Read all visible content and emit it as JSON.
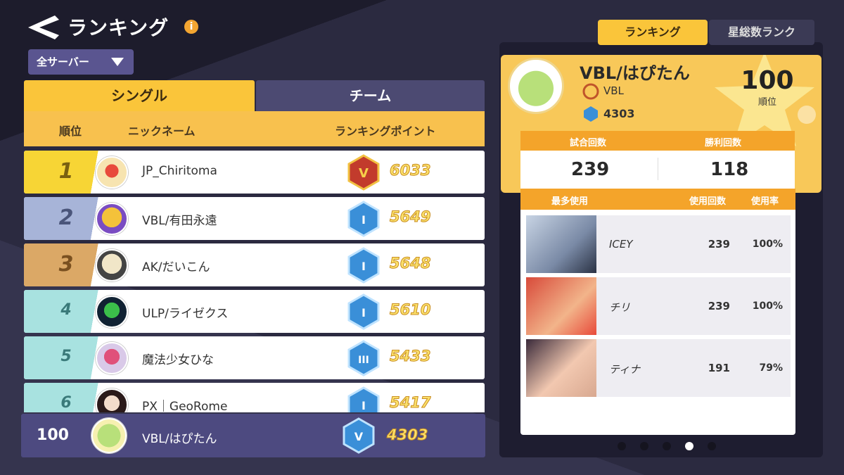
{
  "header": {
    "title": "ランキング",
    "info": "i",
    "server": "全サーバー"
  },
  "tabs": {
    "single": "シングル",
    "team": "チーム"
  },
  "columns": {
    "rank": "順位",
    "nickname": "ニックネーム",
    "points": "ランキングポイント"
  },
  "rows": [
    {
      "rank": "1",
      "nickname": "JP_Chiritoma",
      "points": "6033"
    },
    {
      "rank": "2",
      "nickname": "VBL/有田永遠",
      "points": "5649"
    },
    {
      "rank": "3",
      "nickname": "AK/だいこん",
      "points": "5648"
    },
    {
      "rank": "4",
      "nickname": "ULP/ライゼクス",
      "points": "5610"
    },
    {
      "rank": "5",
      "nickname": "魔法少女ひな",
      "points": "5433"
    },
    {
      "rank": "6",
      "nickname": "PX｜GeoRome",
      "points": "5417"
    }
  ],
  "own": {
    "rank": "100",
    "nickname": "VBL/はぴたん",
    "points": "4303"
  },
  "right_tabs": {
    "ranking": "ランキング",
    "star": "星総数ランク"
  },
  "profile": {
    "name": "VBL/はぴたん",
    "team": "VBL",
    "points": "4303",
    "rank": "100",
    "rank_unit": "順位"
  },
  "stats": {
    "matches_label": "試合回数",
    "wins_label": "勝利回数",
    "matches": "239",
    "wins": "118"
  },
  "most_used": {
    "label": "最多使用",
    "count_label": "使用回数",
    "rate_label": "使用率",
    "heroes": [
      {
        "name": "ICEY",
        "count": "239",
        "rate": "100%"
      },
      {
        "name": "チリ",
        "count": "239",
        "rate": "100%"
      },
      {
        "name": "ティナ",
        "count": "191",
        "rate": "79%"
      }
    ]
  },
  "colors": {
    "gold": "#fac53a",
    "rank1": "#f5d23a",
    "rank2": "#a7b4d8",
    "rank3": "#d9a867",
    "rank_other": "#a8e2e0",
    "own_row": "#4d4a80"
  }
}
